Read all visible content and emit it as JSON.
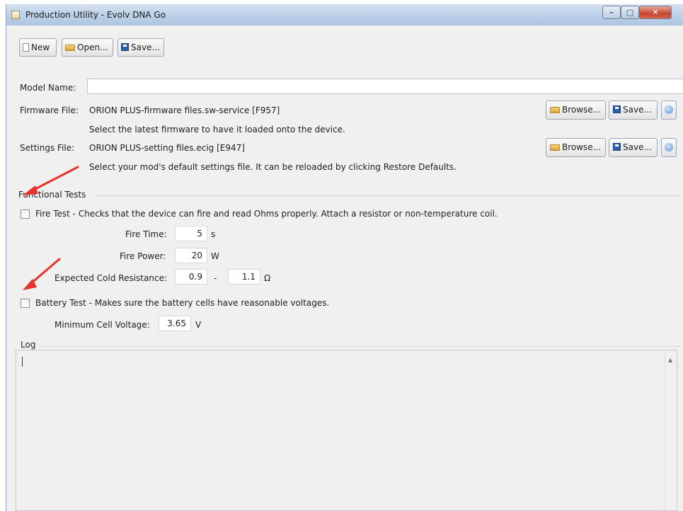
{
  "window": {
    "title": "Production Utility - Evolv DNA Go"
  },
  "toolbar": {
    "new_label": "New",
    "open_label": "Open...",
    "save_label": "Save..."
  },
  "model": {
    "label": "Model Name:",
    "value": ""
  },
  "firmware": {
    "label": "Firmware File:",
    "value": "ORION PLUS-firmware files.sw-service [F957]",
    "hint": "Select the latest firmware to have it loaded onto the device.",
    "browse_label": "Browse...",
    "save_label": "Save..."
  },
  "settings": {
    "label": "Settings File:",
    "value": "ORION PLUS-setting files.ecig [E947]",
    "hint": "Select your mod's default settings file. It can be reloaded by clicking Restore Defaults.",
    "browse_label": "Browse...",
    "save_label": "Save..."
  },
  "functional_tests": {
    "title": "Functional Tests",
    "fire_test": {
      "label": "Fire Test - Checks that the device can fire and read Ohms properly. Attach a resistor or non-temperature coil.",
      "checked": false,
      "fire_time_label": "Fire Time:",
      "fire_time_value": "5",
      "fire_time_unit": "s",
      "fire_power_label": "Fire Power:",
      "fire_power_value": "20",
      "fire_power_unit": "W",
      "resistance_label": "Expected Cold Resistance:",
      "resistance_min": "0.9",
      "resistance_sep": "-",
      "resistance_max": "1.1",
      "resistance_unit": "Ω"
    },
    "battery_test": {
      "label": "Battery Test - Makes sure the battery cells have reasonable voltages.",
      "checked": false,
      "min_voltage_label": "Minimum Cell Voltage:",
      "min_voltage_value": "3.65",
      "min_voltage_unit": "V"
    }
  },
  "log": {
    "title": "Log",
    "content": ""
  },
  "colors": {
    "window_bg": "#f0f0f0",
    "titlebar": "#bcd0e8",
    "close_button": "#c8442f",
    "annotation_arrow": "#e8312a"
  }
}
